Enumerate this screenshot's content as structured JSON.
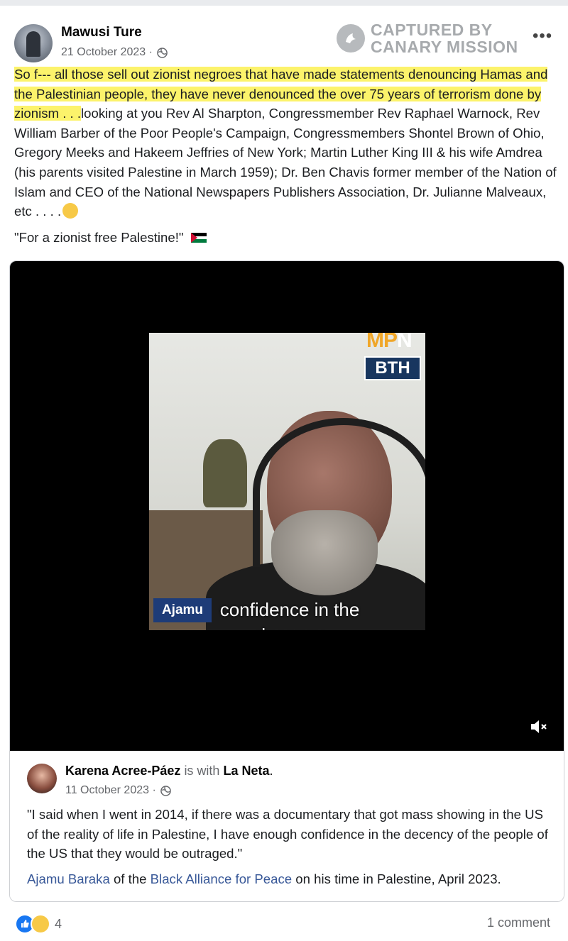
{
  "post": {
    "author": "Mawusi Ture",
    "date": "21 October 2023 ·",
    "text_highlighted": "So f--- all those sell out zionist negroes that have made statements denouncing Hamas and the Palestinian people, they have never denounced the over 75 years of terrorism done by zionism . . .",
    "text_rest": "looking at you Rev Al Sharpton, Congressmember Rev Raphael Warnock, Rev William Barber of the Poor People's Campaign, Congressmembers Shontel Brown of Ohio, Gregory Meeks and Hakeem Jeffries of New York; Martin Luther King III & his wife Amdrea (his parents visited Palestine in March 1959); Dr. Ben Chavis former member of the Nation of Islam and CEO of the National Newspapers Publishers Association, Dr. Julianne Malveaux, etc . . . .",
    "quote": "\"For a zionist free Palestine!\"",
    "highlight_color": "#fcf36b"
  },
  "watermark": {
    "line1": "CAPTURED BY",
    "line2": "CANARY MISSION"
  },
  "video": {
    "logo_mpn_left": "MP",
    "logo_mpn_right": "N",
    "logo_bth": "BTH",
    "name_tag": "Ajamu",
    "caption": "confidence in the decency"
  },
  "shared_post": {
    "author": "Karena Acree-Páez",
    "with_text": "is with",
    "with_page": "La Neta",
    "period": ".",
    "date": "11 October 2023 ·",
    "text": "\"I said when I went in 2014, if there was a documentary that got mass showing in the US of the reality of life in Palestine, I have enough confidence in the decency of the people of the US that they would be outraged.\"",
    "credit_link1": "Ajamu Baraka",
    "credit_mid": " of the ",
    "credit_link2": "Black Alliance for Peace",
    "credit_end": " on his time in Palestine, April 2023."
  },
  "footer": {
    "reaction_count": "4",
    "comments": "1 comment"
  },
  "icons": [
    "globe-icon",
    "more-options-icon",
    "canary-mission-logo",
    "emoji-icon",
    "palestine-flag-icon",
    "mute-icon",
    "like-reaction-icon",
    "haha-reaction-icon"
  ]
}
